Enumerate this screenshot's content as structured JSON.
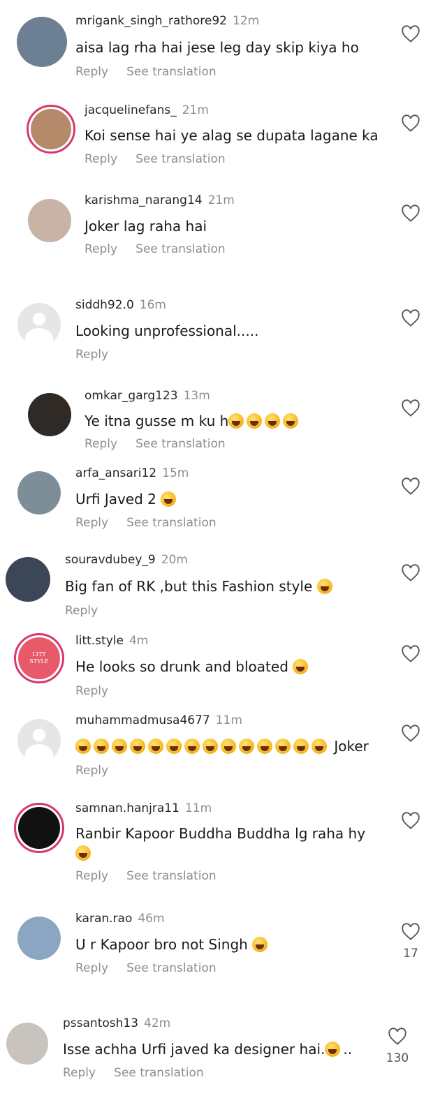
{
  "actions": {
    "reply": "Reply",
    "see_translation": "See translation"
  },
  "comments": [
    {
      "username": "mrigank_singh_rathore92",
      "time": "12m",
      "text": "aisa lag rha hai jese leg day skip kiya ho",
      "avatar_color": "#6d7f93"
    },
    {
      "username": "jacquelinefans_",
      "time": "21m",
      "text": "Koi sense hai ye alag se dupata lagane ka",
      "avatar_color": "#b58a6a"
    },
    {
      "username": "karishma_narang14",
      "time": "21m",
      "text": "Joker lag raha hai",
      "avatar_color": "#c9b3a7"
    },
    {
      "username": "siddh92.0",
      "time": "16m",
      "text": "Looking unprofessional....."
    },
    {
      "username": "omkar_garg123",
      "time": "13m",
      "text": "Ye itna gusse m ku h",
      "avatar_color": "#2f2a26"
    },
    {
      "username": "arfa_ansari12",
      "time": "15m",
      "text": "Urfi Javed  2",
      "avatar_color": "#7d8e99"
    },
    {
      "username": "souravdubey_9",
      "time": "20m",
      "text": "Big fan of RK ,but this Fashion style",
      "avatar_color": "#3b4656"
    },
    {
      "username": "litt.style",
      "time": "4m",
      "text": "He looks so drunk and bloated",
      "avatar_label": "LITT STYLE",
      "avatar_color": "#e85a6a"
    },
    {
      "username": "muhammadmusa4677",
      "time": "11m",
      "text": "Joker"
    },
    {
      "username": "samnan.hanjra11",
      "time": "11m",
      "text": "Ranbir Kapoor Buddha Buddha lg raha hy",
      "avatar_color": "#111111"
    },
    {
      "username": "karan.rao",
      "time": "46m",
      "text": "U r Kapoor bro not Singh",
      "likes": "17",
      "avatar_color": "#8aa6c2"
    },
    {
      "username": "pssantosh13",
      "time": "42m",
      "text": "Isse achha Urfi javed ka designer hai.",
      "text_suffix": "..",
      "likes": "130",
      "avatar_color": "#c9c3bd"
    }
  ]
}
